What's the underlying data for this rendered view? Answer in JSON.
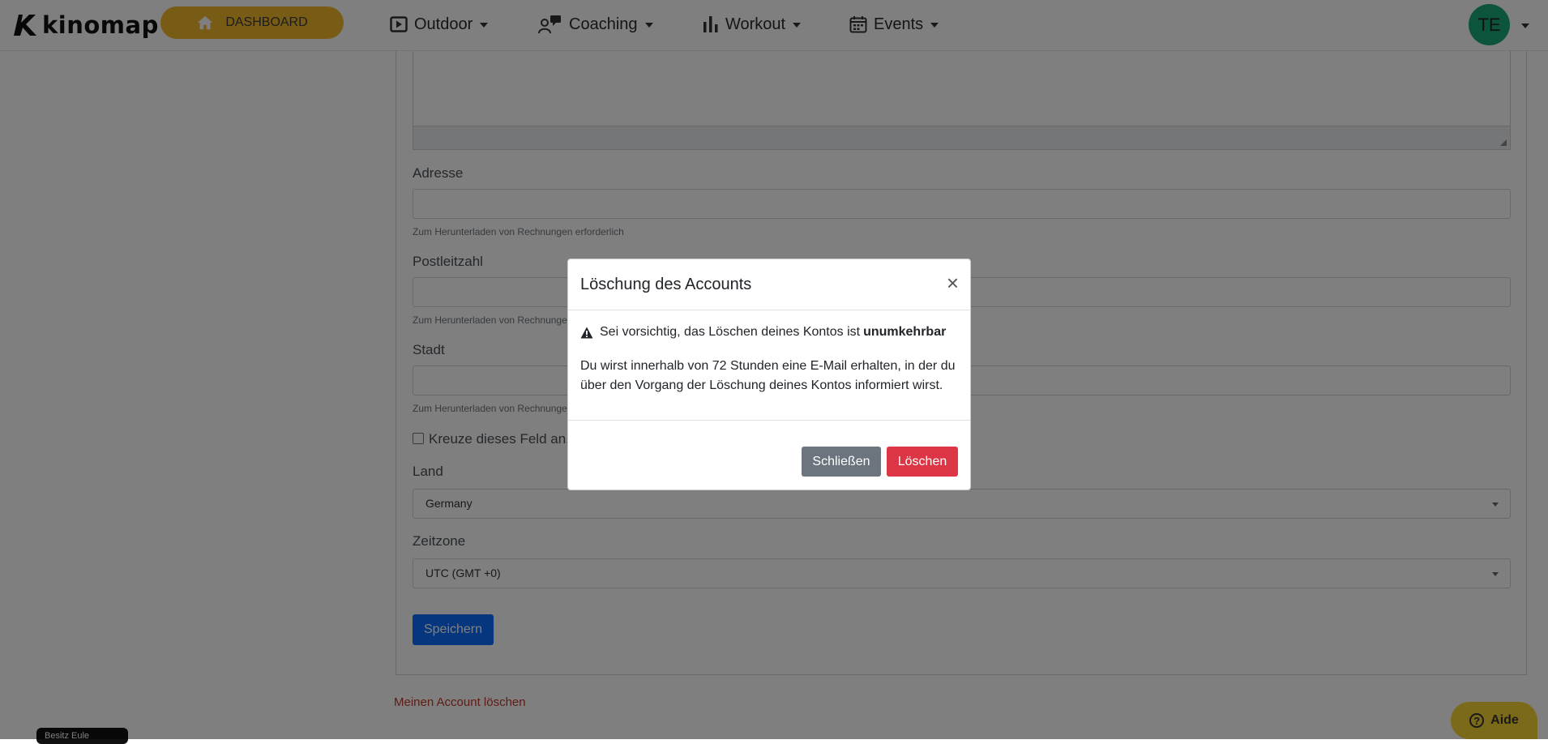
{
  "navbar": {
    "logo_text": "kinomap",
    "dashboard_label": "DASHBOARD",
    "items": [
      {
        "label": "Outdoor",
        "icon": "play-square-icon"
      },
      {
        "label": "Coaching",
        "icon": "coach-chat-icon"
      },
      {
        "label": "Workout",
        "icon": "bar-chart-icon"
      },
      {
        "label": "Events",
        "icon": "calendar-icon"
      }
    ],
    "avatar_initials": "TE",
    "accent_color": "#f1b82c",
    "avatar_color": "#1ba87a"
  },
  "form": {
    "address": {
      "label": "Adresse",
      "value": "",
      "help": "Zum Herunterladen von Rechnungen erforderlich"
    },
    "postal_code": {
      "label": "Postleitzahl",
      "value": "",
      "help": "Zum Herunterladen von Rechnungen erforderlich"
    },
    "city": {
      "label": "Stadt",
      "value": "",
      "help": "Zum Herunterladen von Rechnungen erforderlich"
    },
    "checkbox_label": "Kreuze dieses Feld an, w",
    "country": {
      "label": "Land",
      "value": "Germany"
    },
    "timezone": {
      "label": "Zeitzone",
      "value": "UTC (GMT +0)"
    },
    "save_label": "Speichern",
    "delete_account_link": "Meinen Account löschen"
  },
  "modal": {
    "title": "Löschung des Accounts",
    "close_symbol": "×",
    "warning_text": "Sei vorsichtig, das Löschen deines Kontos ist",
    "warning_strong": "unumkehrbar",
    "body_text": "Du wirst innerhalb von 72 Stunden eine E-Mail erhalten, in der du über den Vorgang der Löschung deines Kontos informiert wirst.",
    "close_button": "Schließen",
    "delete_button": "Löschen"
  },
  "aide_label": "Aide",
  "aide_icon_symbol": "?",
  "toast_text": "Besitz Eule"
}
